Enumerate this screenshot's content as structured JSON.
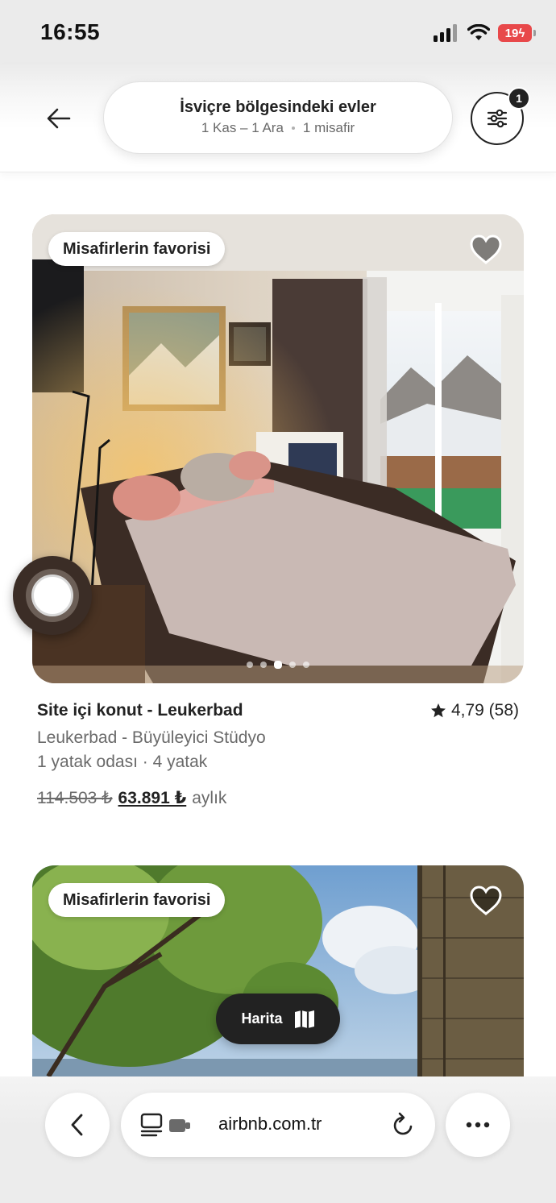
{
  "status_bar": {
    "time": "16:55",
    "battery": "19"
  },
  "header": {
    "search_title": "İsviçre bölgesindeki evler",
    "dates": "1 Kas – 1 Ara",
    "guests": "1 misafir",
    "filter_badge_count": "1",
    "back_icon": "arrow-left-icon",
    "filter_icon": "sliders-icon"
  },
  "listings": [
    {
      "badge": "Misafirlerin favorisi",
      "title": "Site içi konut - Leukerbad",
      "rating": "4,79 (58)",
      "subtitle": "Leukerbad - Büyüleyici Stüdyo",
      "beds": "1 yatak odası · 4 yatak",
      "old_price": "114.503 ₺",
      "new_price": "63.891 ₺",
      "period": "aylık",
      "photo_index": 3,
      "photo_count": 5
    },
    {
      "badge": "Misafirlerin favorisi"
    }
  ],
  "map_button": {
    "label": "Harita"
  },
  "browser": {
    "url": "airbnb.com.tr"
  },
  "colors": {
    "text": "#222222",
    "muted": "#6a6a6a",
    "battery": "#e8484a"
  }
}
